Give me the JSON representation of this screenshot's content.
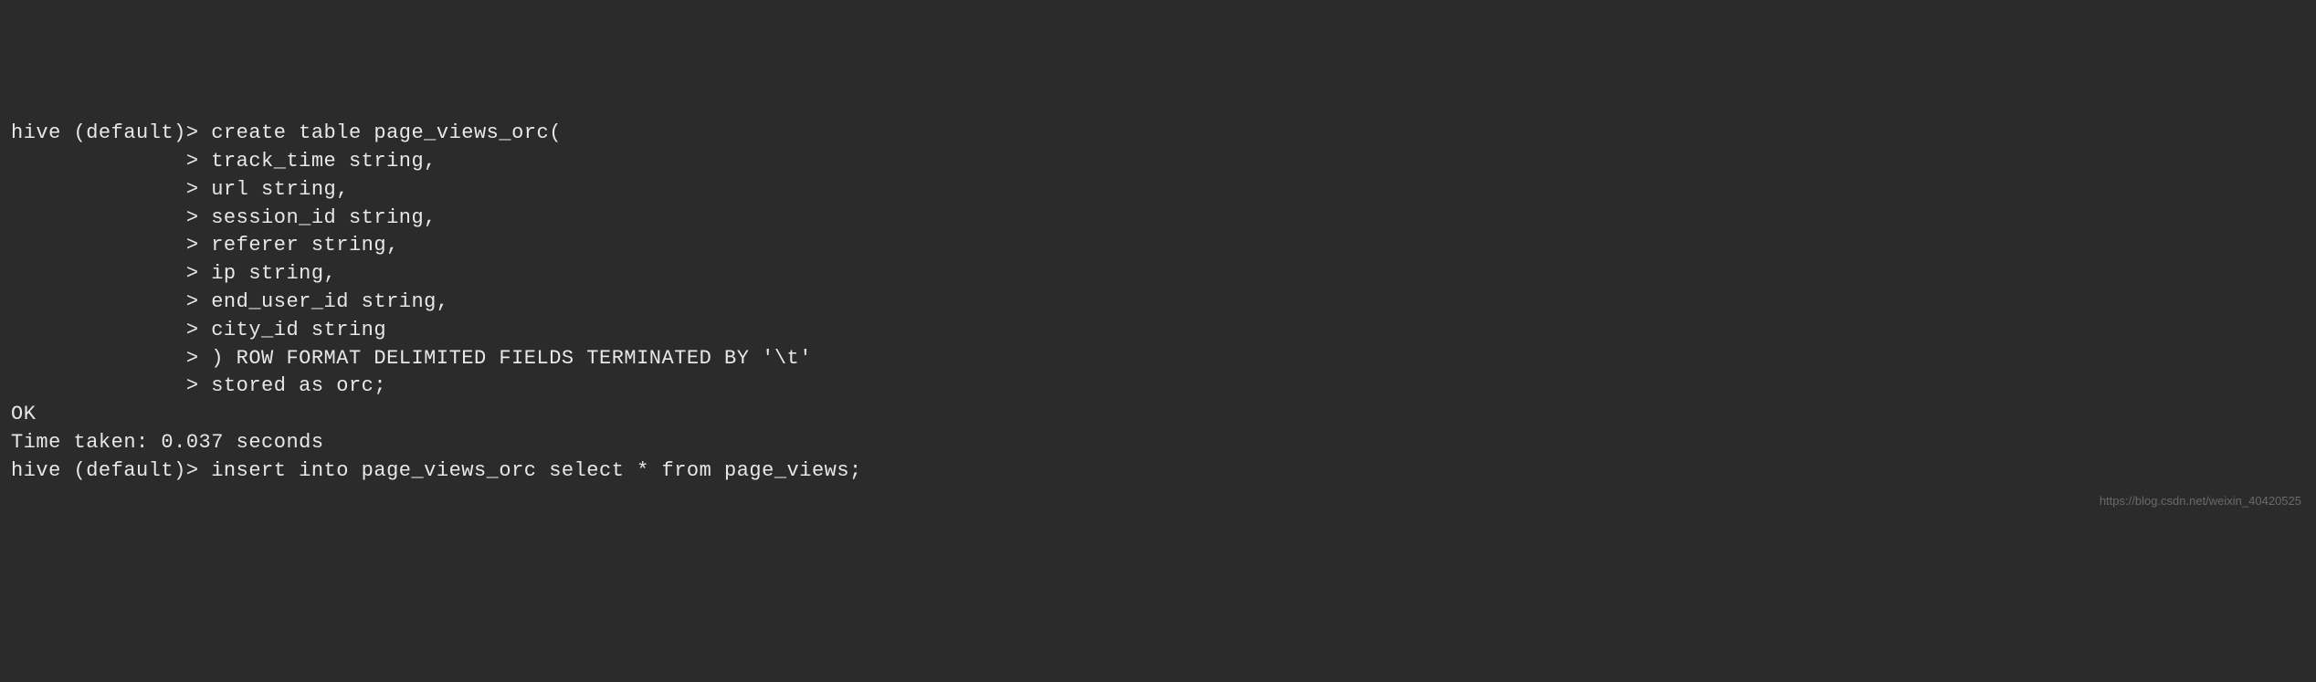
{
  "terminal": {
    "lines": [
      {
        "prompt": "hive (default)> ",
        "text": "create table page_views_orc("
      },
      {
        "prompt": "              > ",
        "text": "track_time string,"
      },
      {
        "prompt": "              > ",
        "text": "url string,"
      },
      {
        "prompt": "              > ",
        "text": "session_id string,"
      },
      {
        "prompt": "              > ",
        "text": "referer string,"
      },
      {
        "prompt": "              > ",
        "text": "ip string,"
      },
      {
        "prompt": "              > ",
        "text": "end_user_id string,"
      },
      {
        "prompt": "              > ",
        "text": "city_id string"
      },
      {
        "prompt": "              > ",
        "text": ") ROW FORMAT DELIMITED FIELDS TERMINATED BY '\\t'"
      },
      {
        "prompt": "              > ",
        "text": "stored as orc;"
      },
      {
        "prompt": "",
        "text": "OK"
      },
      {
        "prompt": "",
        "text": "Time taken: 0.037 seconds"
      },
      {
        "prompt": "hive (default)> ",
        "text": "insert into page_views_orc select * from page_views;"
      }
    ]
  },
  "watermark": "https://blog.csdn.net/weixin_40420525"
}
